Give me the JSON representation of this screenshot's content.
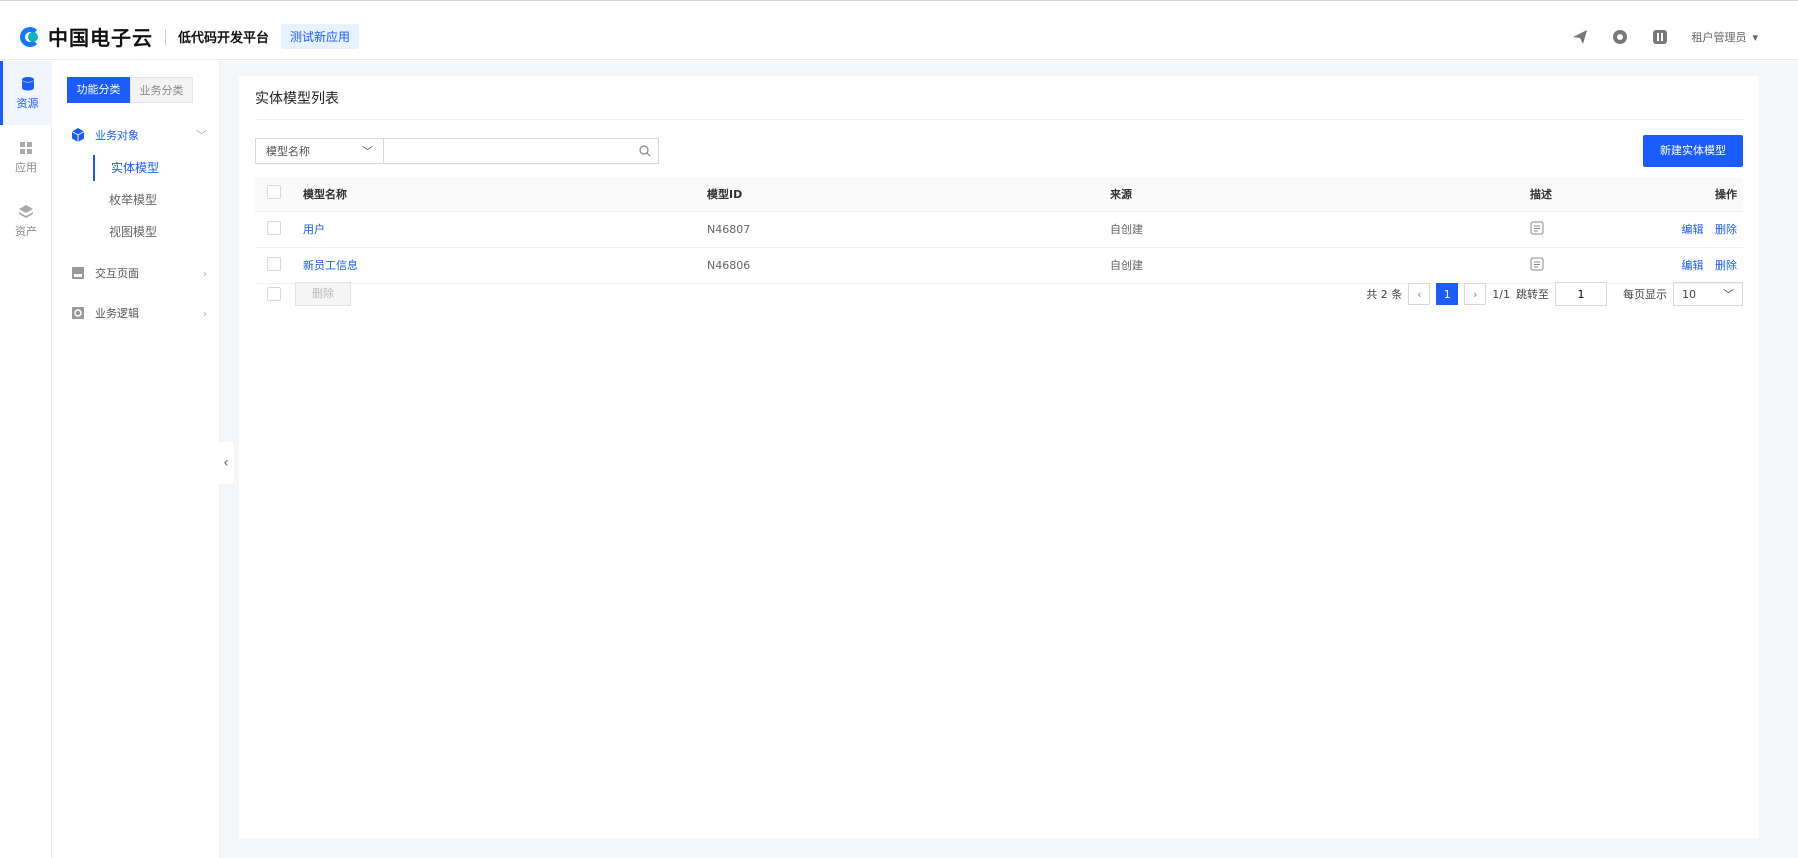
{
  "header": {
    "brand": "中国电子云",
    "platform": "低代码开发平台",
    "app_name": "测试新应用",
    "user": "租户管理员",
    "icons": [
      "send-icon",
      "help-circle-icon",
      "app-switch-icon"
    ]
  },
  "rail": {
    "items": [
      {
        "label": "资源",
        "icon": "database-icon",
        "active": true
      },
      {
        "label": "应用",
        "icon": "grid-icon",
        "active": false
      },
      {
        "label": "资产",
        "icon": "layers-icon",
        "active": false
      }
    ]
  },
  "subnav": {
    "tabs": [
      "功能分类",
      "业务分类"
    ],
    "groups": [
      {
        "label": "业务对象",
        "icon": "cube-icon",
        "expanded": true,
        "children": [
          "实体模型",
          "枚举模型",
          "视图模型"
        ]
      },
      {
        "label": "交互页面",
        "icon": "page-icon",
        "expanded": false
      },
      {
        "label": "业务逻辑",
        "icon": "logic-icon",
        "expanded": false
      }
    ]
  },
  "main": {
    "title": "实体模型列表",
    "filter_field": "模型名称",
    "search_value": "",
    "new_button": "新建实体模型",
    "columns": [
      "模型名称",
      "模型ID",
      "来源",
      "描述",
      "操作"
    ],
    "rows": [
      {
        "name": "用户",
        "id": "N46807",
        "source": "自创建"
      },
      {
        "name": "新员工信息",
        "id": "N46806",
        "source": "自创建"
      }
    ],
    "row_actions": {
      "edit": "编辑",
      "delete": "删除"
    },
    "bulk_delete": "删除",
    "pagination": {
      "total": "共 2 条",
      "current_page": "1",
      "page_info": "1/1",
      "jump_label": "跳转至",
      "jump_value": "1",
      "size_label": "每页显示",
      "size_value": "10"
    }
  },
  "colors": {
    "primary": "#1a5cff",
    "bg": "#f5f6f8"
  }
}
